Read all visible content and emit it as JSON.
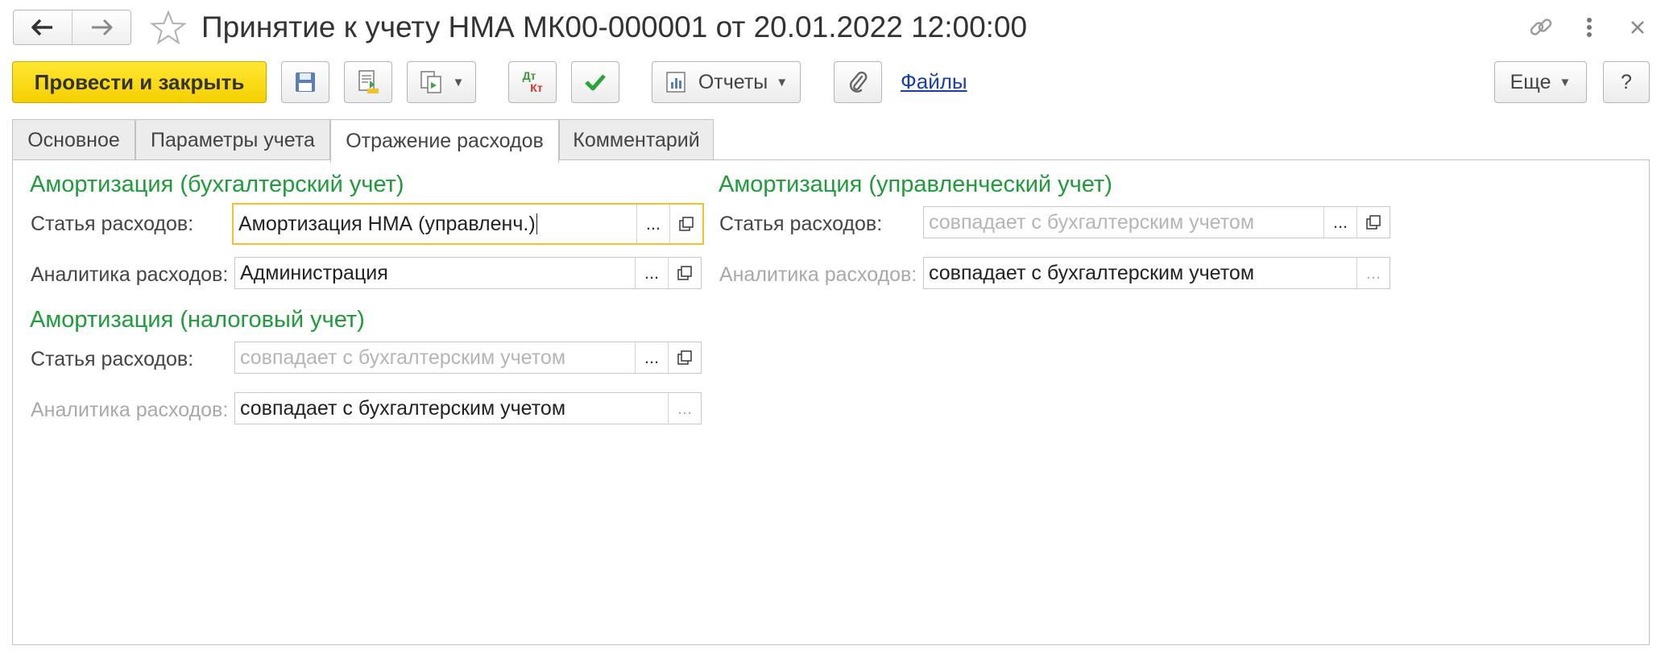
{
  "window": {
    "title": "Принятие к учету НМА МК00-000001 от 20.01.2022 12:00:00",
    "icons": [
      "back-arrow-icon",
      "forward-arrow-icon",
      "star-icon",
      "link-icon",
      "more-vert-icon",
      "close-icon"
    ]
  },
  "toolbar": {
    "post_close_label": "Провести и закрыть",
    "reports_label": "Отчеты",
    "files_label": "Файлы",
    "more_label": "Еще",
    "help_label": "?",
    "dt_label": "Дт",
    "kt_label": "Кт"
  },
  "tabs": [
    {
      "label": "Основное"
    },
    {
      "label": "Параметры учета"
    },
    {
      "label": "Отражение расходов",
      "active": true
    },
    {
      "label": "Комментарий"
    }
  ],
  "form": {
    "accounting": {
      "title": "Амортизация (бухгалтерский учет)",
      "expense_item_label": "Статья расходов:",
      "expense_item_value": "Амортизация НМА (управленч.)",
      "analytics_label": "Аналитика расходов:",
      "analytics_value": "Администрация"
    },
    "tax": {
      "title": "Амортизация (налоговый учет)",
      "expense_item_label": "Статья расходов:",
      "expense_item_placeholder": "совпадает с бухгалтерским учетом",
      "analytics_label": "Аналитика расходов:",
      "analytics_value": "совпадает с бухгалтерским учетом"
    },
    "management": {
      "title": "Амортизация (управленческий учет)",
      "expense_item_label": "Статья расходов:",
      "expense_item_placeholder": "совпадает с бухгалтерским учетом",
      "analytics_label": "Аналитика расходов:",
      "analytics_value": "совпадает с бухгалтерским учетом"
    },
    "select_button": "...",
    "colors": {
      "section_title": "#1f9b3b",
      "focus_border": "#f3c12b",
      "primary_button": "#f5d000",
      "link": "#1a3fa6"
    }
  }
}
